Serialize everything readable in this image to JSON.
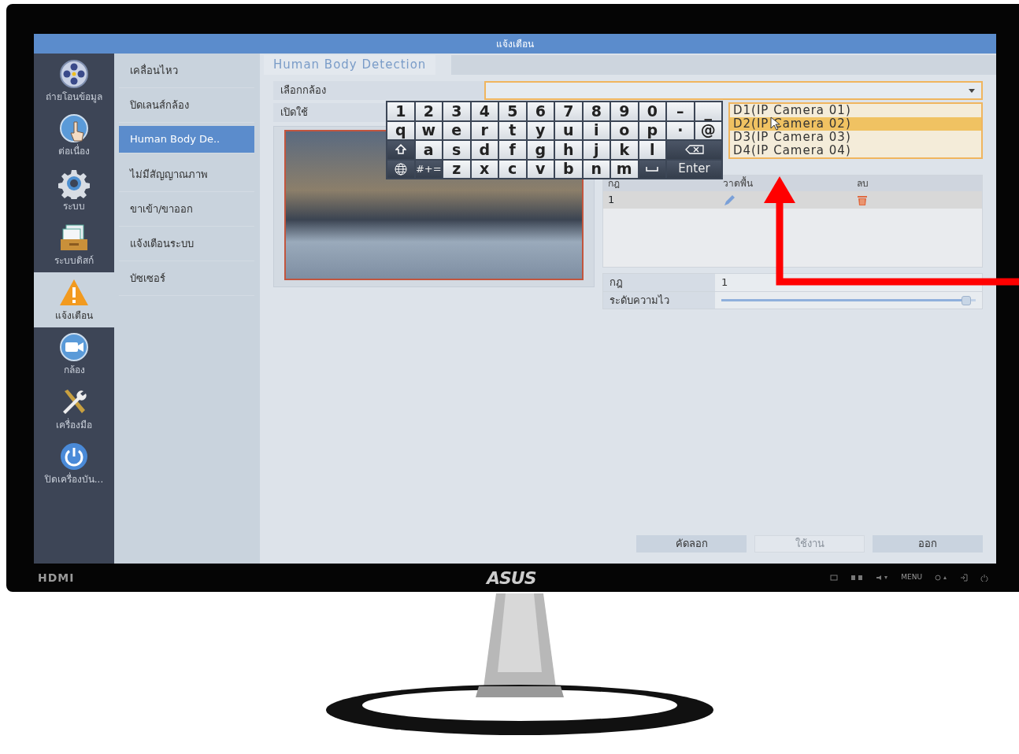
{
  "window": {
    "title": "แจ้งเตือน"
  },
  "sidebar": {
    "items": [
      {
        "label": "ถ่ายโอนข้อมูล",
        "selected": false
      },
      {
        "label": "ต่อเนื่อง",
        "selected": false
      },
      {
        "label": "ระบบ",
        "selected": false
      },
      {
        "label": "ระบบดิสก์",
        "selected": false
      },
      {
        "label": "แจ้งเตือน",
        "selected": true
      },
      {
        "label": "กล้อง",
        "selected": false
      },
      {
        "label": "เครื่องมือ",
        "selected": false
      },
      {
        "label": "ปิดเครื่องบัน...",
        "selected": false
      }
    ]
  },
  "submenu": {
    "items": [
      {
        "label": "เคลื่อนไหว",
        "selected": false
      },
      {
        "label": "ปิดเลนส์กล้อง",
        "selected": false
      },
      {
        "label": "Human Body De..",
        "selected": true
      },
      {
        "label": "ไม่มีสัญญาณภาพ",
        "selected": false
      },
      {
        "label": "ขาเข้า/ขาออก",
        "selected": false
      },
      {
        "label": "แจ้งเตือนระบบ",
        "selected": false
      },
      {
        "label": "บัซเซอร์",
        "selected": false
      }
    ]
  },
  "tab": {
    "label": "Human Body Detection"
  },
  "camera_row": {
    "label": "เลือกกล้อง"
  },
  "enable_row": {
    "label": "เปิดใช้"
  },
  "camera_list": {
    "options": [
      {
        "label": "D1(IP Camera 01)",
        "selected": false
      },
      {
        "label": "D2(IP Camera 02)",
        "selected": true
      },
      {
        "label": "D3(IP Camera 03)",
        "selected": false
      },
      {
        "label": "D4(IP Camera 04)",
        "selected": false
      }
    ]
  },
  "keyboard": {
    "rows": [
      [
        {
          "kind": "key",
          "label": "1"
        },
        {
          "kind": "key",
          "label": "2"
        },
        {
          "kind": "key",
          "label": "3"
        },
        {
          "kind": "key",
          "label": "4"
        },
        {
          "kind": "key",
          "label": "5"
        },
        {
          "kind": "key",
          "label": "6"
        },
        {
          "kind": "key",
          "label": "7"
        },
        {
          "kind": "key",
          "label": "8"
        },
        {
          "kind": "key",
          "label": "9"
        },
        {
          "kind": "key",
          "label": "0"
        },
        {
          "kind": "key",
          "label": "–"
        },
        {
          "kind": "key",
          "label": "_"
        }
      ],
      [
        {
          "kind": "key",
          "label": "q"
        },
        {
          "kind": "key",
          "label": "w"
        },
        {
          "kind": "key",
          "label": "e"
        },
        {
          "kind": "key",
          "label": "r"
        },
        {
          "kind": "key",
          "label": "t"
        },
        {
          "kind": "key",
          "label": "y"
        },
        {
          "kind": "key",
          "label": "u"
        },
        {
          "kind": "key",
          "label": "i"
        },
        {
          "kind": "key",
          "label": "o"
        },
        {
          "kind": "key",
          "label": "p"
        },
        {
          "kind": "key",
          "label": "·"
        },
        {
          "kind": "key",
          "label": "@"
        }
      ],
      [
        {
          "kind": "shift"
        },
        {
          "kind": "key",
          "label": "a"
        },
        {
          "kind": "key",
          "label": "s"
        },
        {
          "kind": "key",
          "label": "d"
        },
        {
          "kind": "key",
          "label": "f"
        },
        {
          "kind": "key",
          "label": "g"
        },
        {
          "kind": "key",
          "label": "h"
        },
        {
          "kind": "key",
          "label": "j"
        },
        {
          "kind": "key",
          "label": "k"
        },
        {
          "kind": "key",
          "label": "l"
        },
        {
          "kind": "backspace"
        }
      ],
      [
        {
          "kind": "globe"
        },
        {
          "kind": "symbols",
          "label": "#+="
        },
        {
          "kind": "key",
          "label": "z"
        },
        {
          "kind": "key",
          "label": "x"
        },
        {
          "kind": "key",
          "label": "c"
        },
        {
          "kind": "key",
          "label": "v"
        },
        {
          "kind": "key",
          "label": "b"
        },
        {
          "kind": "key",
          "label": "n"
        },
        {
          "kind": "key",
          "label": "m"
        },
        {
          "kind": "space"
        },
        {
          "kind": "enter",
          "label": "Enter"
        }
      ]
    ]
  },
  "rules_table": {
    "columns": [
      "กฎ",
      "วาดพื้น",
      "ลบ"
    ],
    "rows": [
      {
        "rule": "1"
      }
    ]
  },
  "properties": [
    {
      "kind": "text",
      "label": "กฎ",
      "value": "1"
    },
    {
      "kind": "slider",
      "label": "ระดับความไว",
      "level": 0.98
    }
  ],
  "buttons": [
    {
      "label": "คัดลอก",
      "disabled": false
    },
    {
      "label": "ใช้งาน",
      "disabled": true
    },
    {
      "label": "ออก",
      "disabled": false
    }
  ],
  "bezel": {
    "input_label": "HDMI",
    "brand": "ASUS",
    "button_label": "MENU"
  }
}
